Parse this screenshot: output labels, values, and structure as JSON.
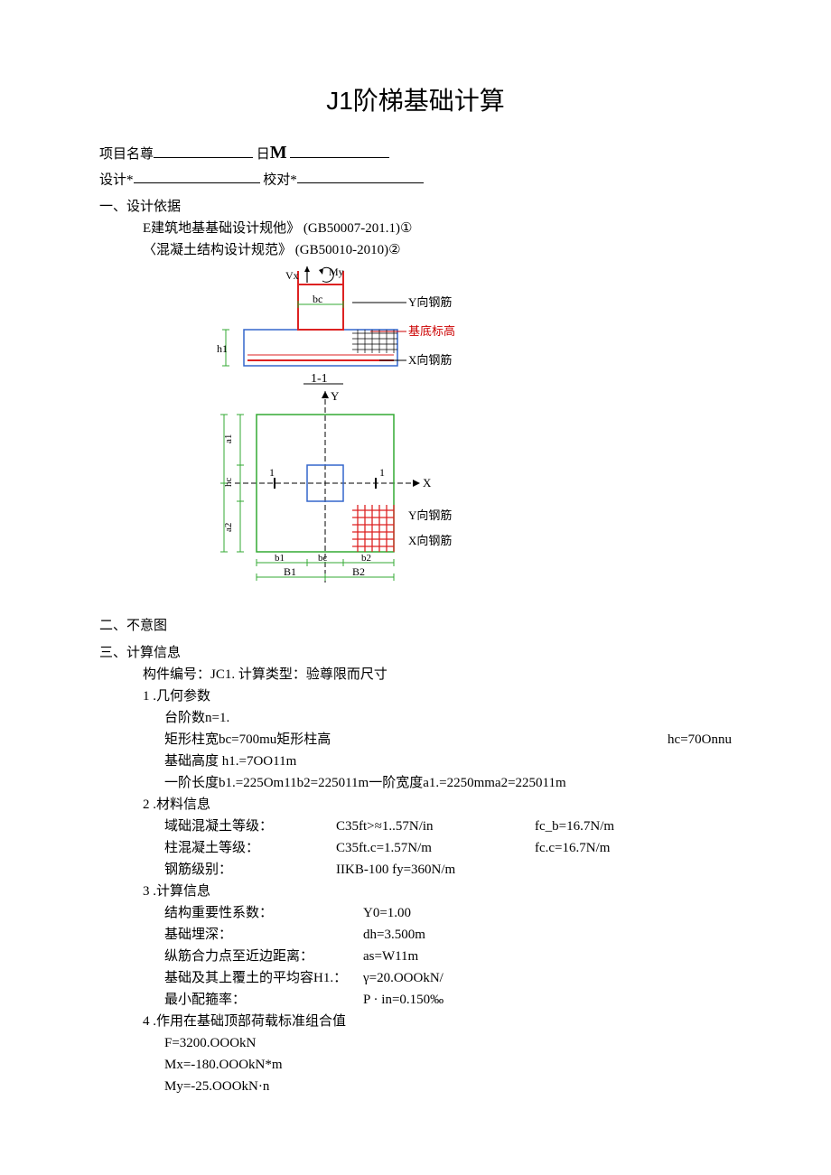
{
  "title": "J1阶梯基础计算",
  "header": {
    "proj_label": "项目名尊",
    "date_label": "日",
    "design_label": "设计*",
    "check_label": "校对*"
  },
  "sec1": {
    "h": "一、设计依据",
    "line1": "E建筑地基基础设计规他》 (GB50007-201.1)①",
    "line2": "〈混凝土结构设计规范》        (GB50010-2010)②"
  },
  "diagram": {
    "vx": "Vx",
    "my": "My",
    "bc": "bc",
    "h1": "h1",
    "y_bar_top": "Y向钢筋",
    "base_label": "基底标高",
    "x_bar_top": "X向钢筋",
    "sec_11": "1-1",
    "Y": "Y",
    "X": "X",
    "A1": "A1",
    "A2": "A2",
    "B1": "B1",
    "B2": "B2",
    "a1": "a1",
    "a2": "a2",
    "hc": "hc",
    "b1": "b1",
    "bc2": "bc",
    "b2": "b2",
    "one": "1",
    "y_bar_bot": "Y向钢筋",
    "x_bar_bot": "X向钢筋"
  },
  "sec2": {
    "h": "二、不意图"
  },
  "sec3": {
    "h": "三、计算信息",
    "comp_no": "构件编号：JC1.           计算类型：验尊限而尺寸",
    "g1_h": "1   .几何参数",
    "g1_l1": "台阶数n=1.",
    "g1_l2a": "矩形柱宽bc=700mu矩形柱高",
    "g1_l2b": "hc=70Onnu",
    "g1_l3": "基础高度      h1.=7OO11m",
    "g1_l4": "一阶长度b1.=225Om11b2=225011m一阶宽度a1.=2250mma2=225011m",
    "g2_h": "2   .材料信息",
    "g2_r1a": "域础混凝土等级：",
    "g2_r1b": "C35ft>≈1..57N/in",
    "g2_r1c": "fc_b=16.7N/m",
    "g2_r2a": "柱混凝土等级：",
    "g2_r2b": "C35ft.c=1.57N/m",
    "g2_r2c": "fc.c=16.7N/m",
    "g2_r3a": "钢筋级别：",
    "g2_r3b": "IIKB-100     fy=360N/m",
    "g3_h": "3   .计算信息",
    "g3_r1a": "结构重要性系数：",
    "g3_r1b": "Y0=1.00",
    "g3_r2a": "基础埋深：",
    "g3_r2b": "dh=3.500m",
    "g3_r3a": "纵筋合力点至近边距离：",
    "g3_r3b": "as=W11m",
    "g3_r4a": "基础及其上覆土的平均容H1.：",
    "g3_r4b": "γ=20.OOOkN/",
    "g3_r5a": "最小配箍率：",
    "g3_r5b": "P · in=0.150‰",
    "g4_h": "4   .作用在基础顶部荷载标准组合值",
    "g4_l1": "F=3200.OOOkN",
    "g4_l2": "Mx=-180.OOOkN*m",
    "g4_l3": "My=-25.OOOkN·n"
  }
}
